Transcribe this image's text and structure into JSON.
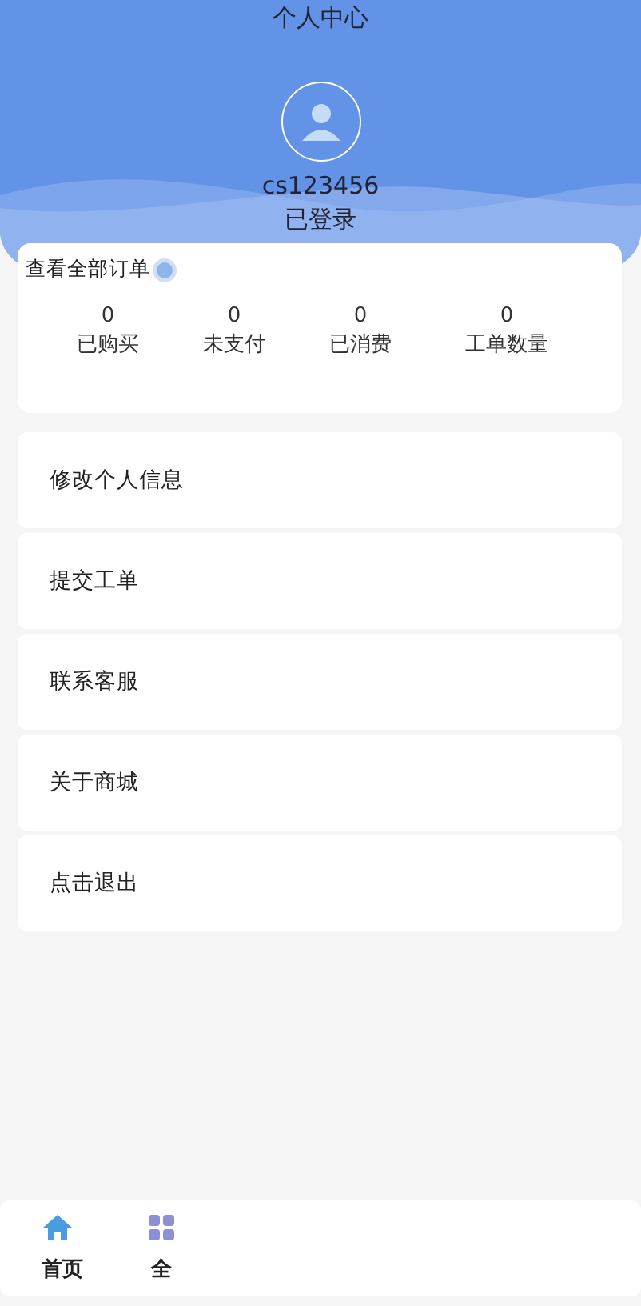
{
  "header": {
    "title": "个人中心",
    "username": "cs123456",
    "status": "已登录"
  },
  "orders": {
    "link": "查看全部订单",
    "stats": [
      {
        "value": "0",
        "label": "已购买"
      },
      {
        "value": "0",
        "label": "未支付"
      },
      {
        "value": "0",
        "label": "已消费"
      },
      {
        "value": "0",
        "label": "工单数量"
      }
    ]
  },
  "menu": [
    "修改个人信息",
    "提交工单",
    "联系客服",
    "关于商城",
    "点击退出"
  ],
  "tab_bar": [
    {
      "label": "首页",
      "kind": "home"
    },
    {
      "label": "全",
      "kind": "grid"
    }
  ]
}
